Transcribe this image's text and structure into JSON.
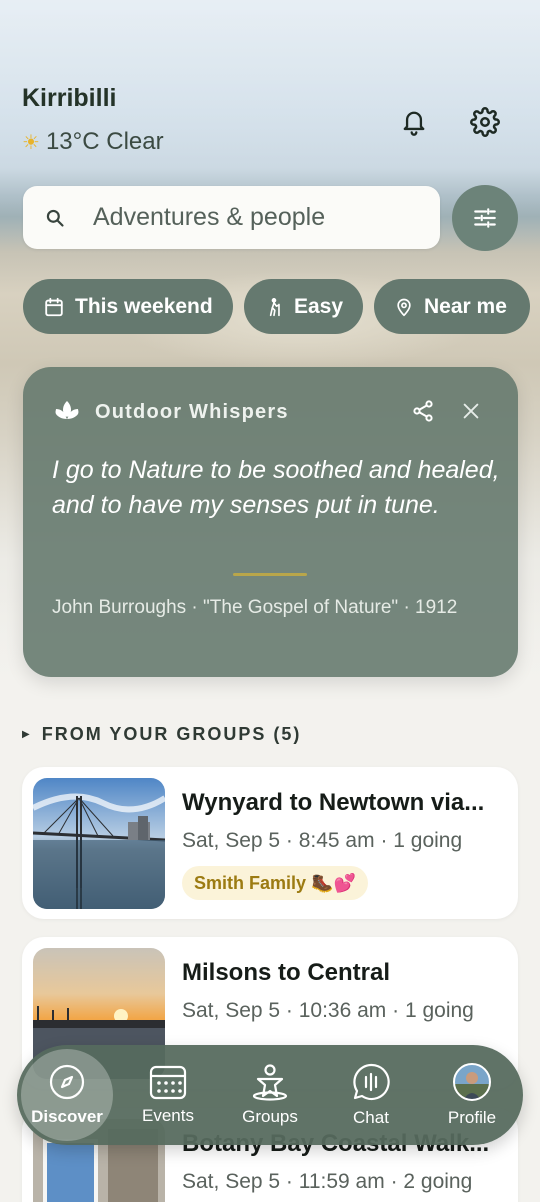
{
  "header": {
    "location": "Kirribilli",
    "weather": "13°C Clear"
  },
  "search": {
    "placeholder": "Adventures & people"
  },
  "chips": [
    {
      "label": "This weekend",
      "icon": "calendar-icon"
    },
    {
      "label": "Easy",
      "icon": "hiker-icon"
    },
    {
      "label": "Near me",
      "icon": "location-pin-icon"
    }
  ],
  "quote_card": {
    "title": "Outdoor Whispers",
    "quote": "I go to Nature to be soothed and healed, and to have my senses put in tune.",
    "attribution": "John Burroughs · \"The Gospel of Nature\" · 1912"
  },
  "groups_section": {
    "title": "FROM YOUR GROUPS (5)"
  },
  "events": [
    {
      "title": "Wynyard to Newtown via...",
      "meta": "Sat, Sep 5 · 8:45 am · 1 going",
      "badge": "Smith Family 🥾💕"
    },
    {
      "title": "Milsons to Central",
      "meta": "Sat, Sep 5 · 10:36 am · 1 going"
    },
    {
      "title": "Botany Bay Coastal Walk...",
      "meta": "Sat, Sep 5 · 11:59 am · 2 going"
    }
  ],
  "tabbar": {
    "items": [
      {
        "label": "Discover",
        "icon": "compass-icon",
        "active": true
      },
      {
        "label": "Events",
        "icon": "calendar-grid-icon"
      },
      {
        "label": "Groups",
        "icon": "group-people-icon"
      },
      {
        "label": "Chat",
        "icon": "chat-bubble-icon"
      },
      {
        "label": "Profile",
        "icon": "avatar"
      }
    ]
  },
  "colors": {
    "accent": "#65796f",
    "badge_text": "#9c7b12",
    "badge_bg": "#fbf3d9"
  }
}
